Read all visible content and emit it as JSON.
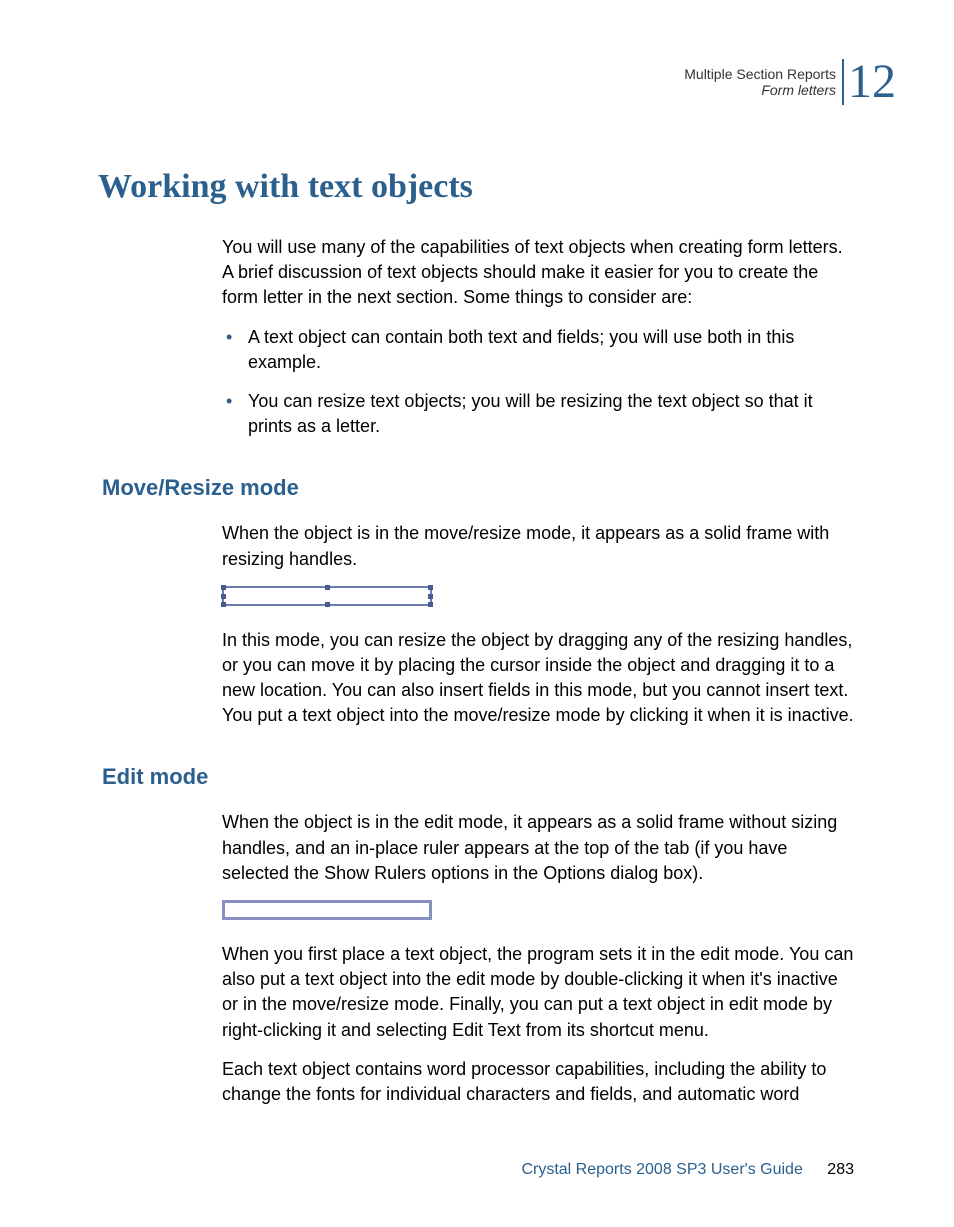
{
  "header": {
    "line1": "Multiple Section Reports",
    "line2": "Form letters",
    "chapter_number": "12"
  },
  "main_heading": "Working with text objects",
  "intro_paragraph": "You will use many of the capabilities of text objects when creating form letters. A brief discussion of text objects should make it easier for you to create the form letter in the next section. Some things to consider are:",
  "bullets": {
    "item1": "A text object can contain both text and fields; you will use both in this example.",
    "item2": "You can resize text objects; you will be resizing the text object so that it prints as a letter."
  },
  "section1": {
    "heading": "Move/Resize mode",
    "para1": "When the object is in the move/resize mode, it appears as a solid frame with resizing handles.",
    "para2": "In this mode, you can resize the object by dragging any of the resizing handles, or you can move it by placing the cursor inside the object and dragging it to a new location. You can also insert fields in this mode, but you cannot insert text. You put a text object into the move/resize mode by clicking it when it is inactive."
  },
  "section2": {
    "heading": "Edit mode",
    "para1": "When the object is in the edit mode, it appears as a solid frame without sizing handles, and an in-place ruler appears at the top of the tab (if you have selected the Show Rulers options in the Options dialog box).",
    "para2": "When you first place a text object, the program sets it in the edit mode. You can also put a text object into the edit mode by double-clicking it when it's inactive or in the move/resize mode. Finally, you can put a text object in edit mode by right-clicking it and selecting Edit Text from its shortcut menu.",
    "para3": "Each text object contains word processor capabilities, including the ability to change the fonts for individual characters and fields, and automatic word"
  },
  "footer": {
    "title": "Crystal Reports 2008 SP3 User's Guide",
    "page": "283"
  }
}
